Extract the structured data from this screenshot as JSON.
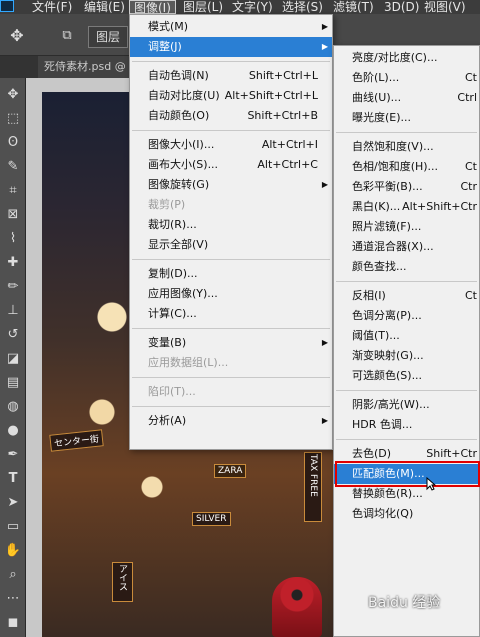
{
  "menubar": {
    "items": [
      {
        "label": "文件(F)"
      },
      {
        "label": "编辑(E)"
      },
      {
        "label": "图像(I)"
      },
      {
        "label": "图层(L)"
      },
      {
        "label": "文字(Y)"
      },
      {
        "label": "选择(S)"
      },
      {
        "label": "滤镜(T)"
      },
      {
        "label": "3D(D)"
      },
      {
        "label": "视图(V)"
      }
    ]
  },
  "options": {
    "layer_button": "图层"
  },
  "document_tab": {
    "title": "死侍素材.psd @"
  },
  "image_menu": {
    "items": [
      {
        "label": "模式(M)",
        "shortcut": "",
        "submenu": true
      },
      {
        "label": "调整(J)",
        "shortcut": "",
        "submenu": true,
        "highlighted": true
      },
      {
        "label": "自动色调(N)",
        "shortcut": "Shift+Ctrl+L"
      },
      {
        "label": "自动对比度(U)",
        "shortcut": "Alt+Shift+Ctrl+L"
      },
      {
        "label": "自动颜色(O)",
        "shortcut": "Shift+Ctrl+B"
      },
      {
        "label": "图像大小(I)...",
        "shortcut": "Alt+Ctrl+I"
      },
      {
        "label": "画布大小(S)...",
        "shortcut": "Alt+Ctrl+C"
      },
      {
        "label": "图像旋转(G)",
        "shortcut": "",
        "submenu": true
      },
      {
        "label": "裁剪(P)",
        "shortcut": "",
        "disabled": true
      },
      {
        "label": "裁切(R)...",
        "shortcut": ""
      },
      {
        "label": "显示全部(V)",
        "shortcut": ""
      },
      {
        "label": "复制(D)...",
        "shortcut": ""
      },
      {
        "label": "应用图像(Y)...",
        "shortcut": ""
      },
      {
        "label": "计算(C)...",
        "shortcut": ""
      },
      {
        "label": "变量(B)",
        "shortcut": "",
        "submenu": true
      },
      {
        "label": "应用数据组(L)...",
        "shortcut": "",
        "disabled": true
      },
      {
        "label": "陷印(T)...",
        "shortcut": "",
        "disabled": true
      },
      {
        "label": "分析(A)",
        "shortcut": "",
        "submenu": true
      }
    ]
  },
  "adjust_menu": {
    "items": [
      {
        "label": "亮度/对比度(C)...",
        "shortcut": ""
      },
      {
        "label": "色阶(L)...",
        "shortcut": "Ct"
      },
      {
        "label": "曲线(U)...",
        "shortcut": "Ctrl"
      },
      {
        "label": "曝光度(E)...",
        "shortcut": ""
      },
      {
        "label": "自然饱和度(V)...",
        "shortcut": ""
      },
      {
        "label": "色相/饱和度(H)...",
        "shortcut": "Ct"
      },
      {
        "label": "色彩平衡(B)...",
        "shortcut": "Ctr"
      },
      {
        "label": "黑白(K)...",
        "shortcut": "Alt+Shift+Ctr"
      },
      {
        "label": "照片滤镜(F)...",
        "shortcut": ""
      },
      {
        "label": "通道混合器(X)...",
        "shortcut": ""
      },
      {
        "label": "颜色查找...",
        "shortcut": ""
      },
      {
        "label": "反相(I)",
        "shortcut": "Ct"
      },
      {
        "label": "色调分离(P)...",
        "shortcut": ""
      },
      {
        "label": "阈值(T)...",
        "shortcut": ""
      },
      {
        "label": "渐变映射(G)...",
        "shortcut": ""
      },
      {
        "label": "可选颜色(S)...",
        "shortcut": ""
      },
      {
        "label": "阴影/高光(W)...",
        "shortcut": ""
      },
      {
        "label": "HDR 色调...",
        "shortcut": ""
      },
      {
        "label": "去色(D)",
        "shortcut": "Shift+Ctr"
      },
      {
        "label": "匹配颜色(M)...",
        "shortcut": "",
        "highlighted": true
      },
      {
        "label": "替换颜色(R)...",
        "shortcut": ""
      },
      {
        "label": "色调均化(Q)",
        "shortcut": ""
      }
    ]
  },
  "canvas_signs": [
    "センター街",
    "ZARA",
    "TAX FREE",
    "SILVER",
    "アイス"
  ],
  "watermark": "Baidu 经验",
  "colors": {
    "highlight": "#2a7fd4",
    "annotation_box": "#e00000"
  }
}
